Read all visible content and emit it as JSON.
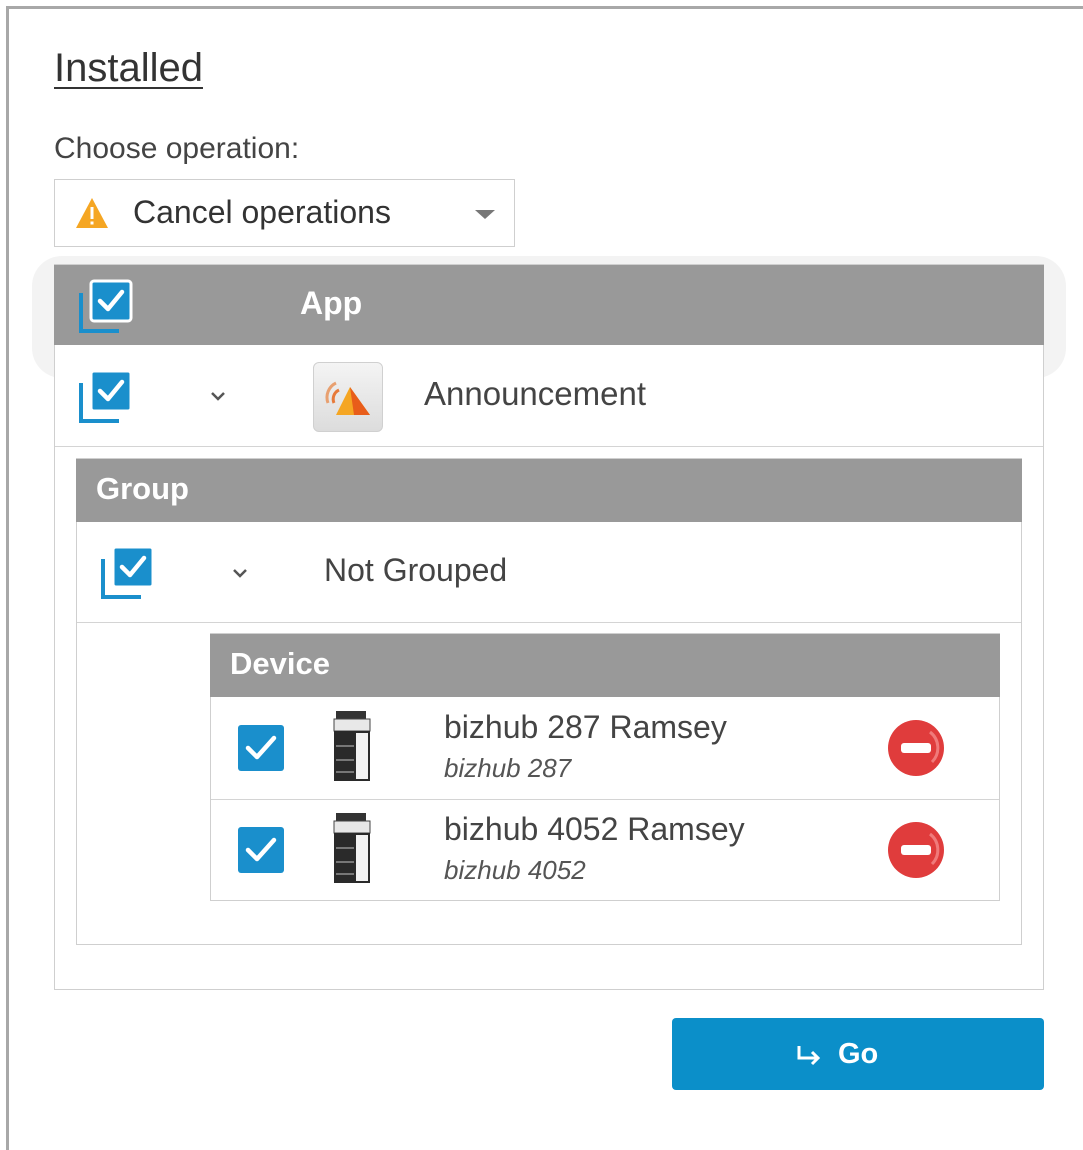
{
  "section": {
    "title": "Installed"
  },
  "operation": {
    "label": "Choose operation:",
    "selected": "Cancel operations",
    "icon": "warning-icon"
  },
  "app_table": {
    "header": "App",
    "row": {
      "name": "Announcement",
      "icon": "announcement-app-icon",
      "checked": true,
      "expanded": true
    }
  },
  "group_table": {
    "header": "Group",
    "row": {
      "name": "Not Grouped",
      "checked": true,
      "expanded": true
    }
  },
  "device_table": {
    "header": "Device",
    "rows": [
      {
        "name": "bizhub 287 Ramsey",
        "model": "bizhub 287",
        "checked": true,
        "icon": "printer-icon"
      },
      {
        "name": "bizhub 4052 Ramsey",
        "model": "bizhub 4052",
        "checked": true,
        "icon": "printer-icon"
      }
    ]
  },
  "go_button": {
    "label": "Go",
    "icon": "enter-arrow-icon"
  },
  "colors": {
    "accent": "#0b8fc9",
    "header_gray": "#999999",
    "warning": "#f5a623",
    "remove_red": "#e03c3c"
  }
}
